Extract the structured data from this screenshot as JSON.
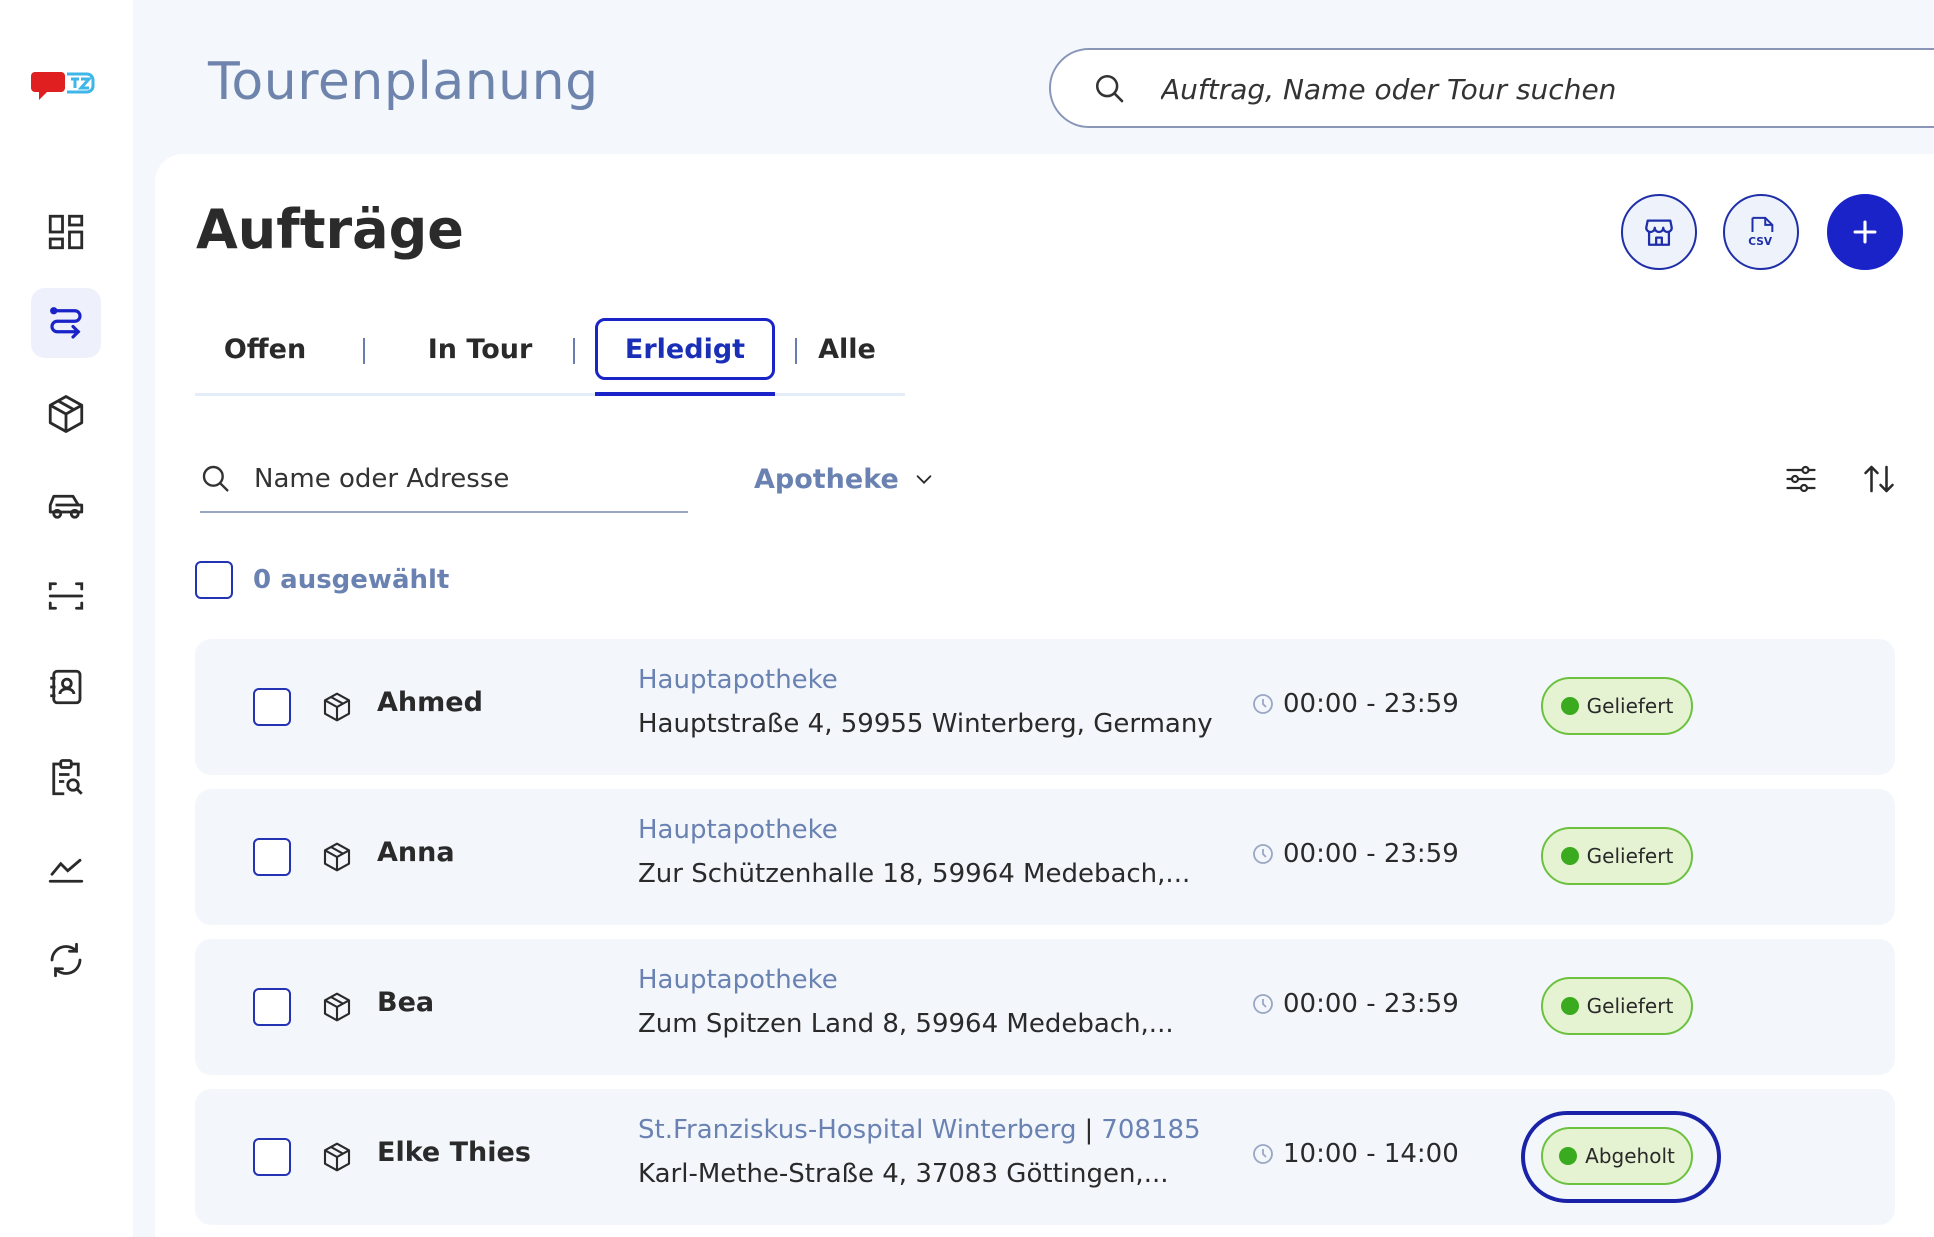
{
  "header": {
    "app_title": "Tourenplanung",
    "search_placeholder": "Auftrag, Name oder Tour suchen"
  },
  "sidebar": {
    "items": [
      {
        "icon": "dashboard-icon"
      },
      {
        "icon": "route-icon",
        "active": true
      },
      {
        "icon": "package-icon"
      },
      {
        "icon": "car-icon"
      },
      {
        "icon": "scan-icon"
      },
      {
        "icon": "contacts-icon"
      },
      {
        "icon": "clipboard-search-icon"
      },
      {
        "icon": "chart-icon"
      },
      {
        "icon": "sync-icon"
      }
    ]
  },
  "page": {
    "title": "Aufträge"
  },
  "tabs": [
    {
      "label": "Offen"
    },
    {
      "label": "In Tour"
    },
    {
      "label": "Erledigt",
      "active": true
    },
    {
      "label": "Alle"
    }
  ],
  "filter": {
    "search_placeholder": "Name oder Adresse",
    "dropdown_value": "Apotheke"
  },
  "selection": {
    "count_label": "0 ausgewählt"
  },
  "orders": [
    {
      "name": "Ahmed",
      "place": "Hauptapotheke",
      "address": "Hauptstraße 4, 59955 Winterberg, Germany",
      "time": "00:00 - 23:59",
      "status": "Geliefert"
    },
    {
      "name": "Anna",
      "place": "Hauptapotheke",
      "address": "Zur Schützenhalle 18, 59964 Medebach,...",
      "time": "00:00 - 23:59",
      "status": "Geliefert"
    },
    {
      "name": "Bea",
      "place": "Hauptapotheke",
      "address": "Zum Spitzen Land 8, 59964 Medebach,...",
      "time": "00:00 - 23:59",
      "status": "Geliefert"
    },
    {
      "name": "Elke Thies",
      "place": "St.Franziskus-Hospital Winterberg",
      "place_id": "708185",
      "address": "Karl-Methe-Straße 4, 37083 Göttingen,...",
      "time": "10:00 - 14:00",
      "status": "Abgeholt"
    }
  ],
  "colors": {
    "primary": "#1a23c7",
    "muted_blue": "#6a82b2",
    "status_green": "#3aaa1f",
    "status_bg": "#e6f3d3",
    "logo_red": "#e02020",
    "logo_cyan": "#3fb6e8"
  }
}
